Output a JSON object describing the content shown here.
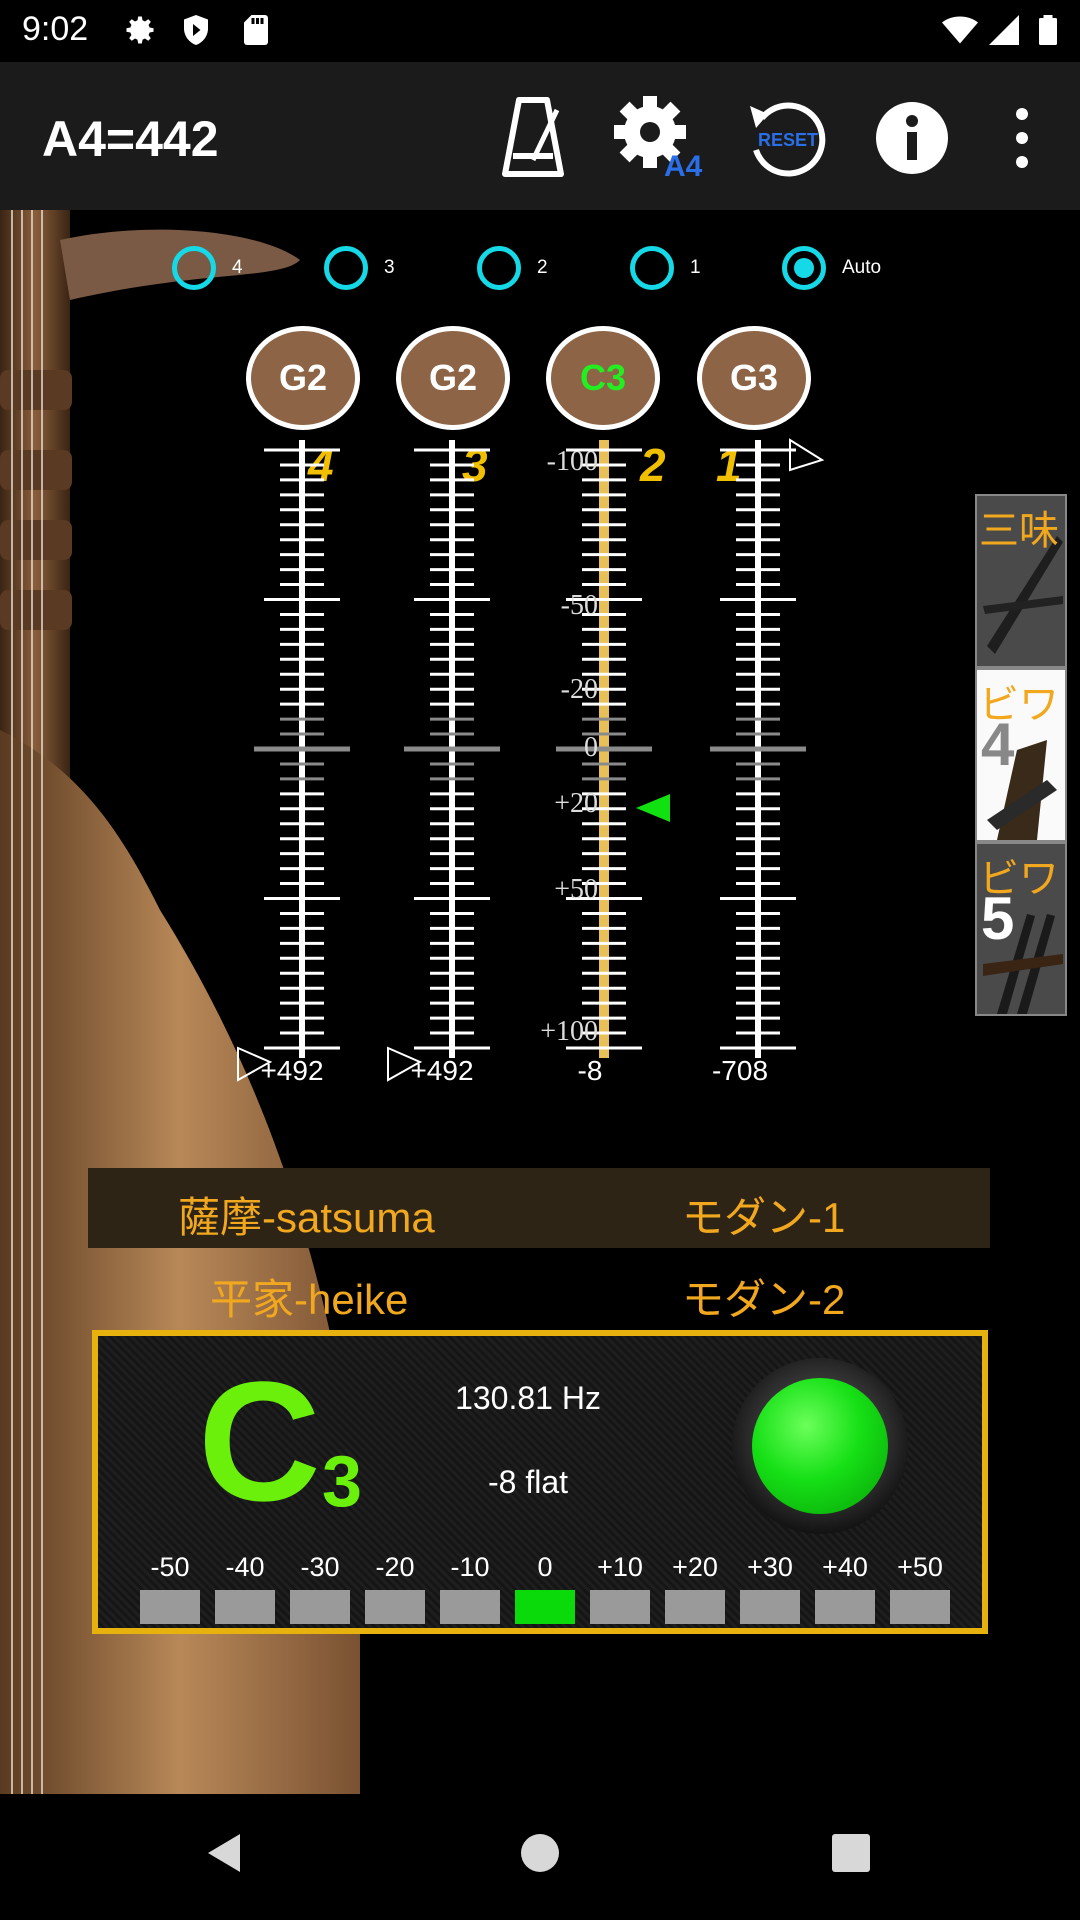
{
  "status": {
    "time": "9:02"
  },
  "app_bar": {
    "title": "A4=442",
    "reset_label": "RESET",
    "a4_label": "A4"
  },
  "string_select": {
    "options": [
      {
        "label": "4",
        "selected": false
      },
      {
        "label": "3",
        "selected": false
      },
      {
        "label": "2",
        "selected": false
      },
      {
        "label": "1",
        "selected": false
      },
      {
        "label": "Auto",
        "selected": true
      }
    ]
  },
  "strings": [
    {
      "number": "4",
      "note": "G2",
      "deviation": "+492",
      "active": false
    },
    {
      "number": "3",
      "note": "G2",
      "deviation": "+492",
      "active": false
    },
    {
      "number": "2",
      "note": "C3",
      "deviation": "-8",
      "active": true
    },
    {
      "number": "1",
      "note": "G3",
      "deviation": "-708",
      "active": false
    }
  ],
  "scale_labels": [
    "-100",
    "-50",
    "-20",
    "0",
    "+20",
    "+50",
    "+100"
  ],
  "modes": {
    "satsuma": "薩摩-satsuma",
    "modern1": "モダン-1",
    "heike": "平家-heike",
    "modern2": "モダン-2"
  },
  "readout": {
    "note": "C",
    "octave": "3",
    "frequency": "130.81 Hz",
    "cents": "-8 flat",
    "meter_labels": [
      "-50",
      "-40",
      "-30",
      "-20",
      "-10",
      "0",
      "+10",
      "+20",
      "+30",
      "+40",
      "+50"
    ],
    "meter_active_index": 5
  },
  "side_instruments": [
    {
      "label": "三味",
      "digit": ""
    },
    {
      "label": "ビワ",
      "digit": "4"
    },
    {
      "label": "ビワ",
      "digit": "5"
    }
  ],
  "colors": {
    "accent_cyan": "#16d9e8",
    "active_green": "#6af00a",
    "gold": "#e8b20e",
    "note_brown": "#8e6446"
  },
  "icons": [
    "settings-icon",
    "shield-icon",
    "sd-card-icon",
    "wifi-icon",
    "signal-icon",
    "battery-icon",
    "metronome-icon",
    "a4-settings-icon",
    "reset-icon",
    "info-icon",
    "overflow-menu-icon",
    "back-icon",
    "home-icon",
    "recents-icon"
  ]
}
